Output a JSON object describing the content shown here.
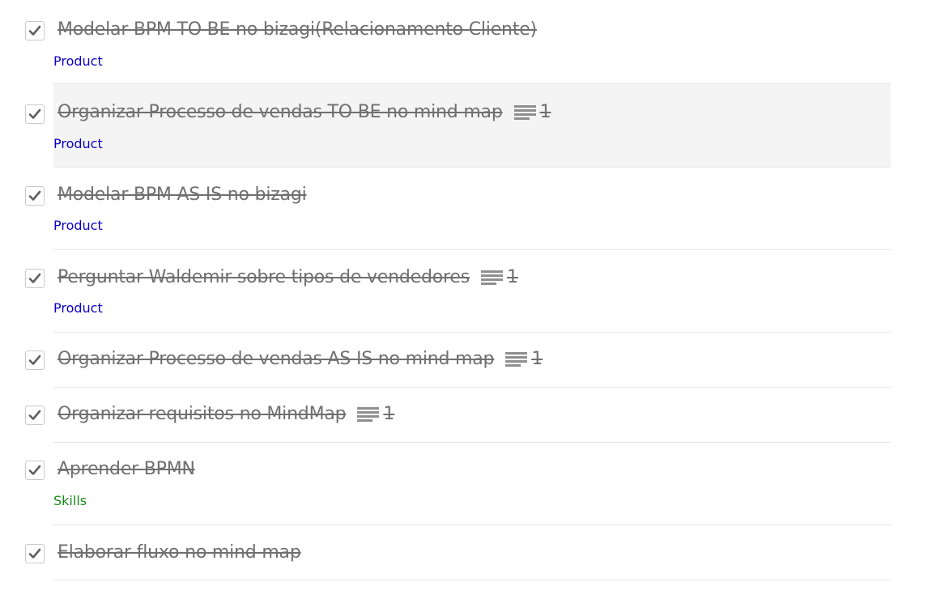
{
  "colors": {
    "tag_product": "#0c00c9",
    "tag_skills": "#1a8a1a",
    "title_text": "#707070",
    "highlight_bg": "#f4f4f4"
  },
  "tasks": [
    {
      "title": "Modelar BPM TO BE no bizagi(Relacionamento Cliente)",
      "completed": true,
      "tag": "Product",
      "tag_type": "product",
      "notes": null,
      "highlighted": false
    },
    {
      "title": "Organizar Processo de vendas TO BE no mind map",
      "completed": true,
      "tag": "Product",
      "tag_type": "product",
      "notes": "1",
      "highlighted": true
    },
    {
      "title": "Modelar BPM AS IS no bizagi",
      "completed": true,
      "tag": "Product",
      "tag_type": "product",
      "notes": null,
      "highlighted": false
    },
    {
      "title": "Perguntar Waldemir sobre tipos de vendedores",
      "completed": true,
      "tag": "Product",
      "tag_type": "product",
      "notes": "1",
      "highlighted": false
    },
    {
      "title": "Organizar Processo de vendas AS IS no mind map",
      "completed": true,
      "tag": null,
      "tag_type": null,
      "notes": "1",
      "highlighted": false
    },
    {
      "title": "Organizar requisitos no MindMap",
      "completed": true,
      "tag": null,
      "tag_type": null,
      "notes": "1",
      "highlighted": false
    },
    {
      "title": "Aprender BPMN",
      "completed": true,
      "tag": "Skills",
      "tag_type": "skills",
      "notes": null,
      "highlighted": false
    },
    {
      "title": "Elaborar fluxo no mind map",
      "completed": true,
      "tag": null,
      "tag_type": null,
      "notes": null,
      "highlighted": false
    }
  ]
}
